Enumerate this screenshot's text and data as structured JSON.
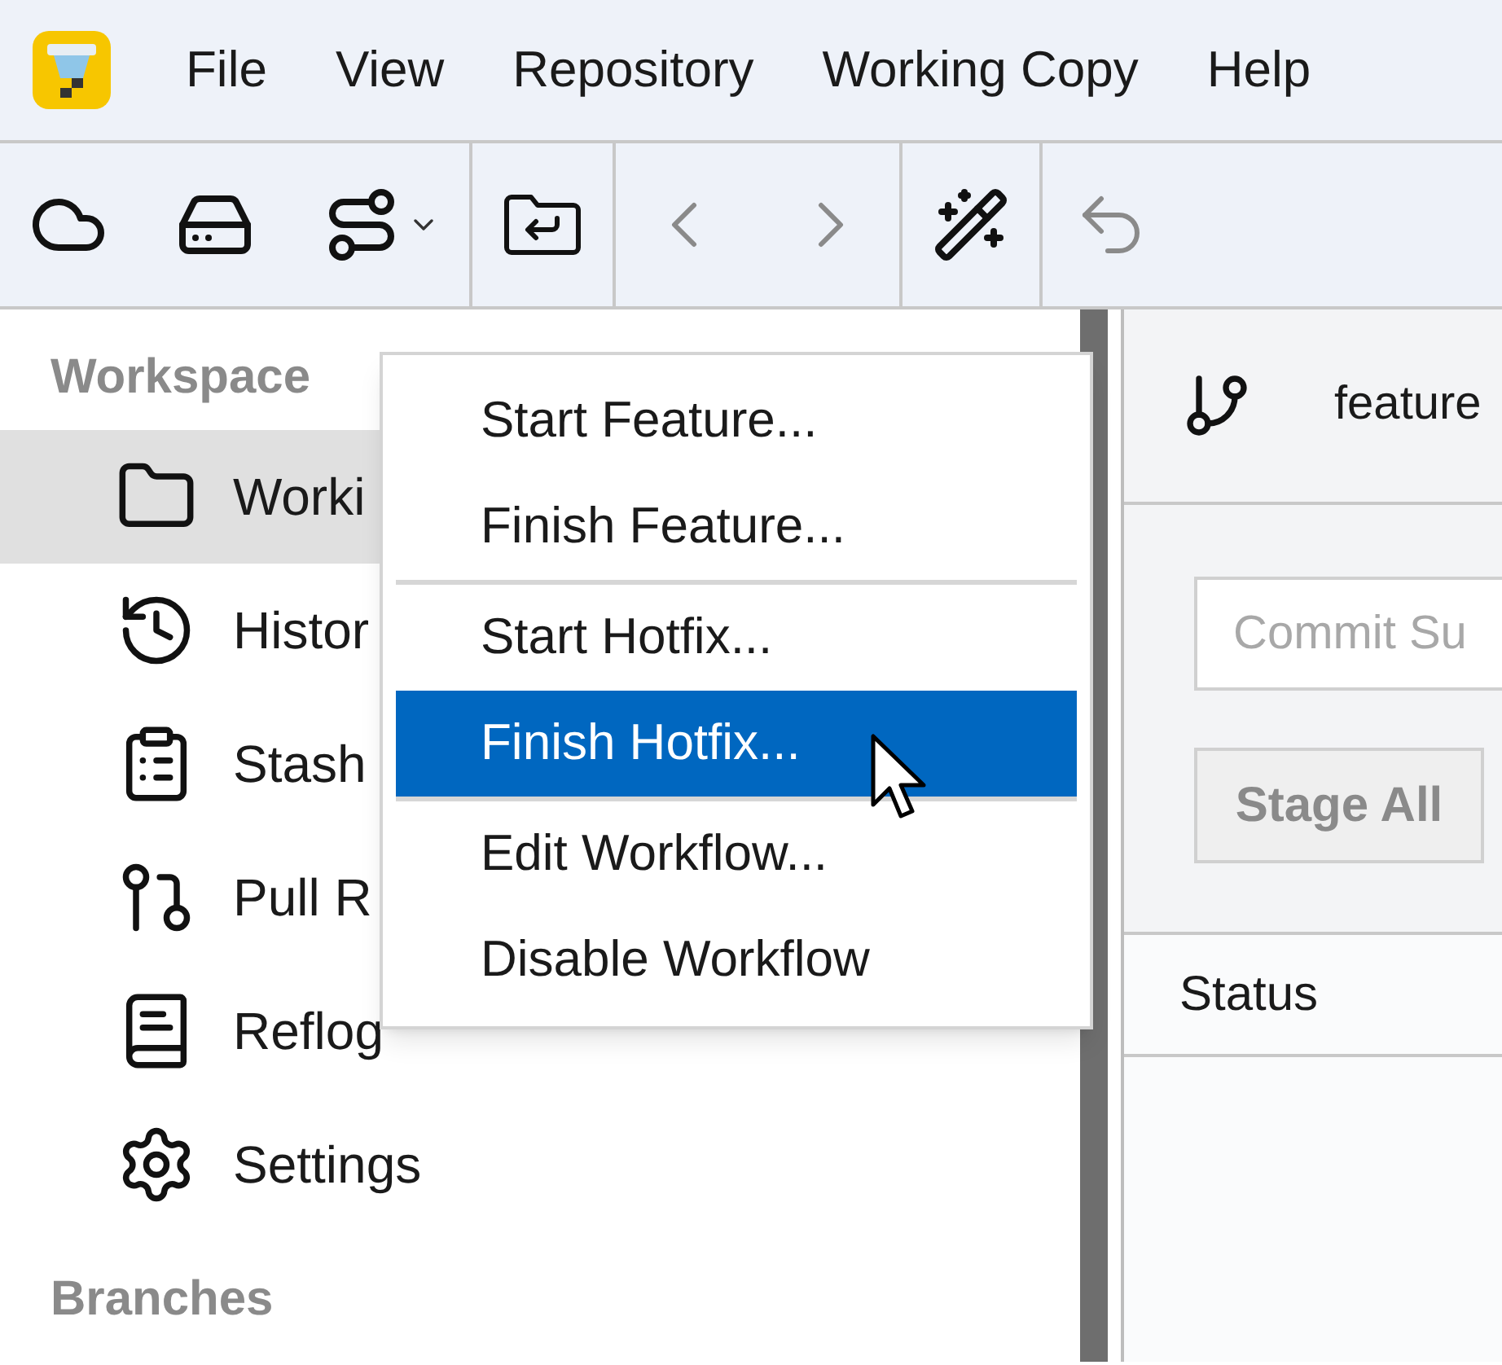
{
  "menubar": {
    "items": [
      "File",
      "View",
      "Repository",
      "Working Copy",
      "Help"
    ]
  },
  "toolbar": {
    "groups": [
      [
        {
          "disabled": false,
          "has_menu": false
        },
        {
          "disabled": false,
          "has_menu": false
        },
        {
          "disabled": false,
          "has_menu": true
        }
      ],
      [
        {
          "disabled": false,
          "has_menu": false
        }
      ],
      [
        {
          "disabled": true,
          "has_menu": false
        },
        {
          "disabled": true,
          "has_menu": false
        }
      ],
      [
        {
          "disabled": false,
          "has_menu": false
        }
      ],
      [
        {
          "disabled": true,
          "has_menu": false
        }
      ]
    ]
  },
  "sidebar": {
    "sections": [
      {
        "title": "Workspace",
        "items": [
          {
            "label": "Worki",
            "selected": true
          },
          {
            "label": "Histor",
            "selected": false
          },
          {
            "label": "Stash",
            "selected": false
          },
          {
            "label": "Pull R",
            "selected": false
          },
          {
            "label": "Reflog",
            "selected": false
          },
          {
            "label": "Settings",
            "selected": false
          }
        ]
      },
      {
        "title": "Branches"
      }
    ]
  },
  "dropdown_menu": {
    "groups": [
      [
        {
          "label": "Start Feature...",
          "selected": false
        },
        {
          "label": "Finish Feature...",
          "selected": false
        }
      ],
      [
        {
          "label": "Start Hotfix...",
          "selected": false
        },
        {
          "label": "Finish Hotfix...",
          "selected": true
        }
      ],
      [
        {
          "label": "Edit Workflow...",
          "selected": false
        },
        {
          "label": "Disable Workflow",
          "selected": false
        }
      ]
    ]
  },
  "main": {
    "branch": "feature",
    "commit_field": {
      "placeholder": "Commit Su"
    },
    "stage_button": {
      "label": "Stage All",
      "disabled": true
    },
    "status_header": "Status"
  }
}
